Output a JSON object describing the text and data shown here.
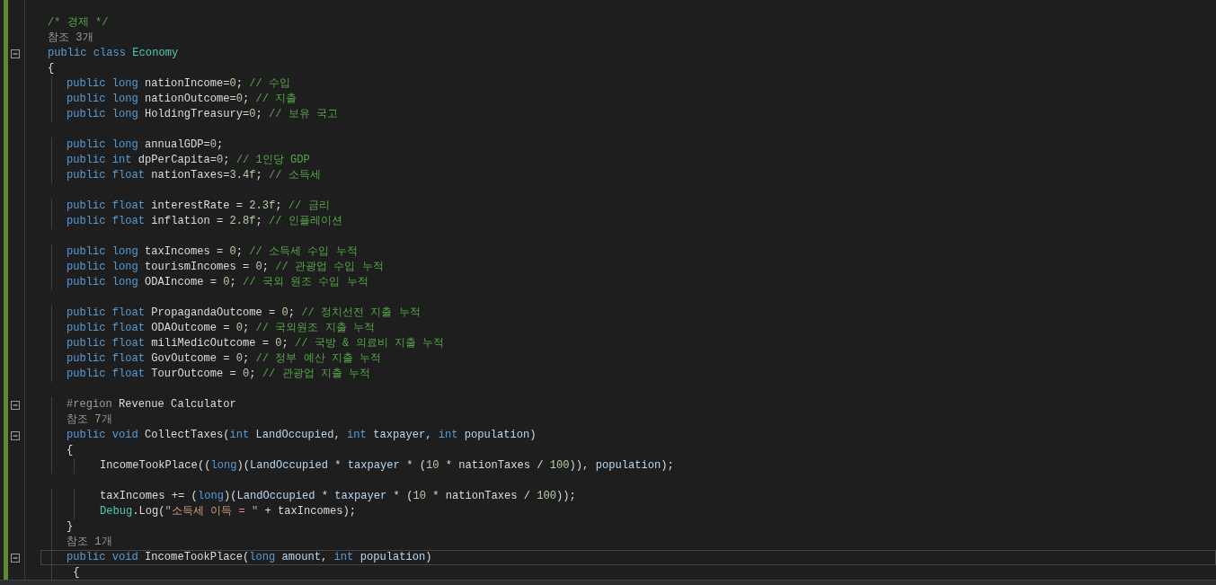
{
  "editor": {
    "lines": [
      {
        "kind": "blank"
      },
      {
        "kind": "code",
        "fold": false,
        "current": false,
        "tokens": [
          {
            "kind": "comment",
            "text": "/* 경제 */"
          }
        ]
      },
      {
        "kind": "codelens",
        "text": "참조 3개"
      },
      {
        "kind": "code",
        "fold": true,
        "current": false,
        "tokens": [
          {
            "kind": "keyword",
            "text": "public class "
          },
          {
            "kind": "type",
            "text": "Economy"
          }
        ]
      },
      {
        "kind": "code",
        "fold": false,
        "current": false,
        "tokens": [
          {
            "kind": "plain",
            "text": "{"
          }
        ]
      },
      {
        "kind": "group",
        "children": [
          {
            "kind": "code",
            "fold": false,
            "current": false,
            "tokens": [
              {
                "kind": "keyword",
                "text": "public long "
              },
              {
                "kind": "plain",
                "text": "nationIncome="
              },
              {
                "kind": "number",
                "text": "0"
              },
              {
                "kind": "plain",
                "text": "; "
              },
              {
                "kind": "comment",
                "text": "// 수입"
              }
            ]
          },
          {
            "kind": "code",
            "fold": false,
            "current": false,
            "tokens": [
              {
                "kind": "keyword",
                "text": "public long "
              },
              {
                "kind": "plain",
                "text": "nationOutcome="
              },
              {
                "kind": "number",
                "text": "0"
              },
              {
                "kind": "plain",
                "text": "; "
              },
              {
                "kind": "comment",
                "text": "// 지출"
              }
            ]
          },
          {
            "kind": "code",
            "fold": false,
            "current": false,
            "tokens": [
              {
                "kind": "keyword",
                "text": "public long "
              },
              {
                "kind": "plain",
                "text": "HoldingTreasury="
              },
              {
                "kind": "number",
                "text": "0"
              },
              {
                "kind": "plain",
                "text": "; "
              },
              {
                "kind": "comment",
                "text": "// 보유 국고"
              }
            ]
          },
          {
            "kind": "blank"
          },
          {
            "kind": "code",
            "fold": false,
            "current": false,
            "tokens": [
              {
                "kind": "keyword",
                "text": "public long "
              },
              {
                "kind": "plain",
                "text": "annualGDP="
              },
              {
                "kind": "number",
                "text": "0"
              },
              {
                "kind": "plain",
                "text": ";"
              }
            ]
          },
          {
            "kind": "code",
            "fold": false,
            "current": false,
            "tokens": [
              {
                "kind": "keyword",
                "text": "public int "
              },
              {
                "kind": "plain",
                "text": "dpPerCapita="
              },
              {
                "kind": "number",
                "text": "0"
              },
              {
                "kind": "plain",
                "text": "; "
              },
              {
                "kind": "comment",
                "text": "// 1인당 GDP"
              }
            ]
          },
          {
            "kind": "code",
            "fold": false,
            "current": false,
            "tokens": [
              {
                "kind": "keyword",
                "text": "public float "
              },
              {
                "kind": "plain",
                "text": "nationTaxes="
              },
              {
                "kind": "number",
                "text": "3.4f"
              },
              {
                "kind": "plain",
                "text": "; "
              },
              {
                "kind": "comment",
                "text": "// 소득세"
              }
            ]
          },
          {
            "kind": "blank"
          },
          {
            "kind": "code",
            "fold": false,
            "current": false,
            "tokens": [
              {
                "kind": "keyword",
                "text": "public float "
              },
              {
                "kind": "plain",
                "text": "interestRate = "
              },
              {
                "kind": "number",
                "text": "2.3f"
              },
              {
                "kind": "plain",
                "text": "; "
              },
              {
                "kind": "comment",
                "text": "// 금리"
              }
            ]
          },
          {
            "kind": "code",
            "fold": false,
            "current": false,
            "tokens": [
              {
                "kind": "keyword",
                "text": "public float "
              },
              {
                "kind": "plain",
                "text": "inflation = "
              },
              {
                "kind": "number",
                "text": "2.8f"
              },
              {
                "kind": "plain",
                "text": "; "
              },
              {
                "kind": "comment",
                "text": "// 인플레이션"
              }
            ]
          },
          {
            "kind": "blank"
          },
          {
            "kind": "code",
            "fold": false,
            "current": false,
            "tokens": [
              {
                "kind": "keyword",
                "text": "public long "
              },
              {
                "kind": "plain",
                "text": "taxIncomes = "
              },
              {
                "kind": "number",
                "text": "0"
              },
              {
                "kind": "plain",
                "text": "; "
              },
              {
                "kind": "comment",
                "text": "// 소득세 수입 누적"
              }
            ]
          },
          {
            "kind": "code",
            "fold": false,
            "current": false,
            "tokens": [
              {
                "kind": "keyword",
                "text": "public long "
              },
              {
                "kind": "plain",
                "text": "tourismIncomes = "
              },
              {
                "kind": "number",
                "text": "0"
              },
              {
                "kind": "plain",
                "text": "; "
              },
              {
                "kind": "comment",
                "text": "// 관광업 수입 누적"
              }
            ]
          },
          {
            "kind": "code",
            "fold": false,
            "current": false,
            "tokens": [
              {
                "kind": "keyword",
                "text": "public long "
              },
              {
                "kind": "plain",
                "text": "ODAIncome = "
              },
              {
                "kind": "number",
                "text": "0"
              },
              {
                "kind": "plain",
                "text": "; "
              },
              {
                "kind": "comment",
                "text": "// 국외 원조 수입 누적"
              }
            ]
          },
          {
            "kind": "blank"
          },
          {
            "kind": "code",
            "fold": false,
            "current": false,
            "tokens": [
              {
                "kind": "keyword",
                "text": "public float "
              },
              {
                "kind": "plain",
                "text": "PropagandaOutcome = "
              },
              {
                "kind": "number",
                "text": "0"
              },
              {
                "kind": "plain",
                "text": "; "
              },
              {
                "kind": "comment",
                "text": "// 정치선전 지출 누적"
              }
            ]
          },
          {
            "kind": "code",
            "fold": false,
            "current": false,
            "tokens": [
              {
                "kind": "keyword",
                "text": "public float "
              },
              {
                "kind": "plain",
                "text": "ODAOutcome = "
              },
              {
                "kind": "number",
                "text": "0"
              },
              {
                "kind": "plain",
                "text": "; "
              },
              {
                "kind": "comment",
                "text": "// 국외원조 지출 누적"
              }
            ]
          },
          {
            "kind": "code",
            "fold": false,
            "current": false,
            "tokens": [
              {
                "kind": "keyword",
                "text": "public float "
              },
              {
                "kind": "plain",
                "text": "miliMedicOutcome = "
              },
              {
                "kind": "number",
                "text": "0"
              },
              {
                "kind": "plain",
                "text": "; "
              },
              {
                "kind": "comment",
                "text": "// 국방 & 의료비 지출 누적"
              }
            ]
          },
          {
            "kind": "code",
            "fold": false,
            "current": false,
            "tokens": [
              {
                "kind": "keyword",
                "text": "public float "
              },
              {
                "kind": "plain",
                "text": "GovOutcome = "
              },
              {
                "kind": "number",
                "text": "0"
              },
              {
                "kind": "plain",
                "text": "; "
              },
              {
                "kind": "comment",
                "text": "// 정부 예산 지출 누적"
              }
            ]
          },
          {
            "kind": "code",
            "fold": false,
            "current": false,
            "tokens": [
              {
                "kind": "keyword",
                "text": "public float "
              },
              {
                "kind": "plain",
                "text": "TourOutcome = "
              },
              {
                "kind": "number",
                "text": "0"
              },
              {
                "kind": "plain",
                "text": "; "
              },
              {
                "kind": "comment",
                "text": "// 관광업 지출 누적"
              }
            ]
          },
          {
            "kind": "blank"
          },
          {
            "kind": "code",
            "fold": true,
            "current": false,
            "tokens": [
              {
                "kind": "directive",
                "text": "#region "
              },
              {
                "kind": "plain",
                "text": "Revenue Calculator"
              }
            ]
          },
          {
            "kind": "codelens",
            "text": "참조 7개"
          },
          {
            "kind": "code",
            "fold": true,
            "current": false,
            "tokens": [
              {
                "kind": "keyword",
                "text": "public void "
              },
              {
                "kind": "method",
                "text": "CollectTaxes"
              },
              {
                "kind": "plain",
                "text": "("
              },
              {
                "kind": "keyword",
                "text": "int "
              },
              {
                "kind": "parameter",
                "text": "LandOccupied"
              },
              {
                "kind": "plain",
                "text": ", "
              },
              {
                "kind": "keyword",
                "text": "int "
              },
              {
                "kind": "parameter",
                "text": "taxpayer"
              },
              {
                "kind": "plain",
                "text": ", "
              },
              {
                "kind": "keyword",
                "text": "int "
              },
              {
                "kind": "parameter",
                "text": "population"
              },
              {
                "kind": "plain",
                "text": ")"
              }
            ]
          },
          {
            "kind": "code",
            "fold": false,
            "current": false,
            "tokens": [
              {
                "kind": "plain",
                "text": "{"
              }
            ]
          },
          {
            "kind": "group",
            "children": [
              {
                "kind": "code",
                "fold": false,
                "current": false,
                "tokens": [
                  {
                    "kind": "method",
                    "text": "IncomeTookPlace"
                  },
                  {
                    "kind": "plain",
                    "text": "(("
                  },
                  {
                    "kind": "keyword",
                    "text": "long"
                  },
                  {
                    "kind": "plain",
                    "text": ")("
                  },
                  {
                    "kind": "parameter",
                    "text": "LandOccupied"
                  },
                  {
                    "kind": "plain",
                    "text": " * "
                  },
                  {
                    "kind": "parameter",
                    "text": "taxpayer"
                  },
                  {
                    "kind": "plain",
                    "text": " * ("
                  },
                  {
                    "kind": "number",
                    "text": "10"
                  },
                  {
                    "kind": "plain",
                    "text": " * nationTaxes / "
                  },
                  {
                    "kind": "number",
                    "text": "100"
                  },
                  {
                    "kind": "plain",
                    "text": ")), "
                  },
                  {
                    "kind": "parameter",
                    "text": "population"
                  },
                  {
                    "kind": "plain",
                    "text": ");"
                  }
                ]
              },
              {
                "kind": "blank"
              },
              {
                "kind": "code",
                "fold": false,
                "current": false,
                "tokens": [
                  {
                    "kind": "plain",
                    "text": "taxIncomes += ("
                  },
                  {
                    "kind": "keyword",
                    "text": "long"
                  },
                  {
                    "kind": "plain",
                    "text": ")("
                  },
                  {
                    "kind": "parameter",
                    "text": "LandOccupied"
                  },
                  {
                    "kind": "plain",
                    "text": " * "
                  },
                  {
                    "kind": "parameter",
                    "text": "taxpayer"
                  },
                  {
                    "kind": "plain",
                    "text": " * ("
                  },
                  {
                    "kind": "number",
                    "text": "10"
                  },
                  {
                    "kind": "plain",
                    "text": " * nationTaxes / "
                  },
                  {
                    "kind": "number",
                    "text": "100"
                  },
                  {
                    "kind": "plain",
                    "text": "));"
                  }
                ]
              },
              {
                "kind": "code",
                "fold": false,
                "current": false,
                "tokens": [
                  {
                    "kind": "type",
                    "text": "Debug"
                  },
                  {
                    "kind": "plain",
                    "text": "."
                  },
                  {
                    "kind": "method",
                    "text": "Log"
                  },
                  {
                    "kind": "plain",
                    "text": "("
                  },
                  {
                    "kind": "string",
                    "text": "\"소득세 이득 = \""
                  },
                  {
                    "kind": "plain",
                    "text": " + taxIncomes);"
                  }
                ]
              }
            ]
          },
          {
            "kind": "code",
            "fold": false,
            "current": false,
            "tokens": [
              {
                "kind": "plain",
                "text": "}"
              }
            ]
          },
          {
            "kind": "codelens",
            "text": "참조 1개"
          },
          {
            "kind": "code",
            "fold": true,
            "current": true,
            "tokens": [
              {
                "kind": "keyword",
                "text": "public void "
              },
              {
                "kind": "method",
                "text": "IncomeTookPlace"
              },
              {
                "kind": "plain",
                "text": "("
              },
              {
                "kind": "keyword",
                "text": "long "
              },
              {
                "kind": "parameter",
                "text": "amount"
              },
              {
                "kind": "plain",
                "text": ", "
              },
              {
                "kind": "keyword",
                "text": "int "
              },
              {
                "kind": "parameter",
                "text": "population"
              },
              {
                "kind": "plain",
                "text": ")"
              }
            ]
          },
          {
            "kind": "code",
            "fold": false,
            "current": false,
            "tokens": [
              {
                "kind": "plain",
                "text": " {"
              }
            ]
          }
        ]
      }
    ]
  }
}
